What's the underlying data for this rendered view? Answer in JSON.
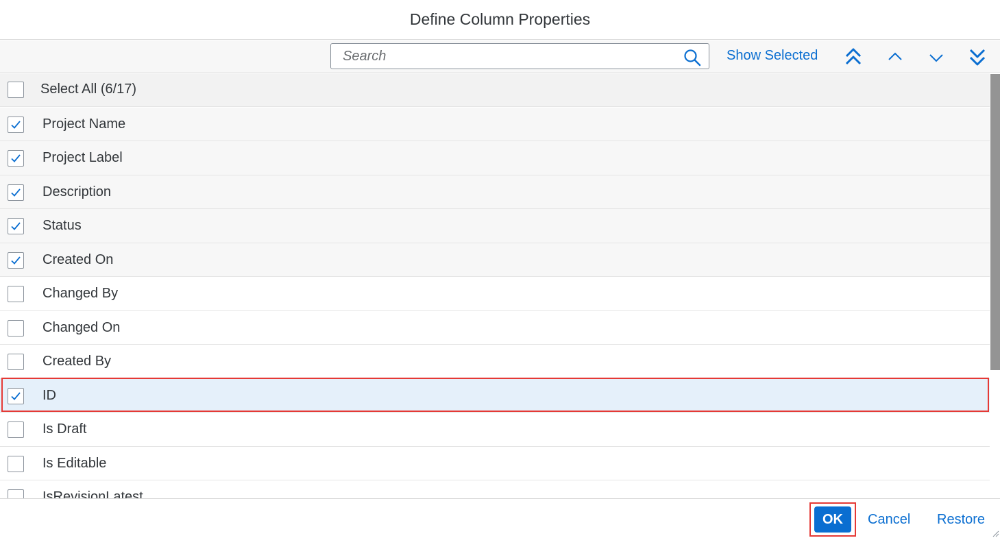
{
  "dialog": {
    "title": "Define Column Properties"
  },
  "toolbar": {
    "search_placeholder": "Search",
    "search_value": "",
    "show_selected_label": "Show Selected",
    "move_buttons": [
      "move-to-top",
      "move-up",
      "move-down",
      "move-to-bottom"
    ]
  },
  "list": {
    "select_all_label": "Select All (6/17)",
    "items": [
      {
        "label": "Project Name",
        "checked": true
      },
      {
        "label": "Project Label",
        "checked": true
      },
      {
        "label": "Description",
        "checked": true
      },
      {
        "label": "Status",
        "checked": true
      },
      {
        "label": "Created On",
        "checked": true
      },
      {
        "label": "Changed By",
        "checked": false
      },
      {
        "label": "Changed On",
        "checked": false
      },
      {
        "label": "Created By",
        "checked": false
      },
      {
        "label": "ID",
        "checked": true,
        "focused": true
      },
      {
        "label": "Is Draft",
        "checked": false
      },
      {
        "label": "Is Editable",
        "checked": false
      },
      {
        "label": "IsRevisionLatest",
        "checked": false
      }
    ]
  },
  "footer": {
    "ok_label": "OK",
    "cancel_label": "Cancel",
    "restore_label": "Restore"
  },
  "colors": {
    "accent": "#0a6ed1",
    "highlight_border": "#e53935",
    "focused_row": "#e5f0fa"
  }
}
